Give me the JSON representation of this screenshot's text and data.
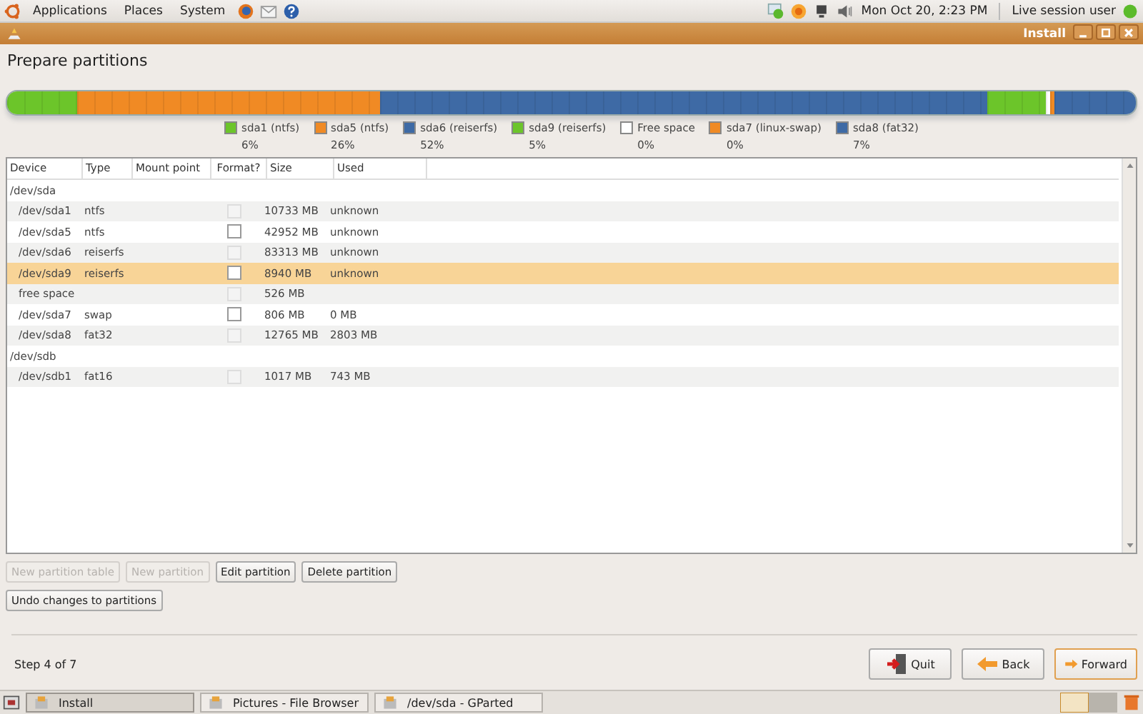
{
  "top_panel": {
    "menus": [
      "Applications",
      "Places",
      "System"
    ],
    "clock": "Mon Oct 20,  2:23 PM",
    "user": "Live session user"
  },
  "window": {
    "title": "Install"
  },
  "heading": "Prepare partitions",
  "partitions_bar": [
    {
      "name": "sda1 (ntfs)",
      "percent": "6%",
      "color": "#6cc52a"
    },
    {
      "name": "sda5 (ntfs)",
      "percent": "26%",
      "color": "#f08a24"
    },
    {
      "name": "sda6 (reiserfs)",
      "percent": "52%",
      "color": "#3e6aa5"
    },
    {
      "name": "sda9 (reiserfs)",
      "percent": "5%",
      "color": "#6cc52a"
    },
    {
      "name": "Free space",
      "percent": "0%",
      "color": "#ffffff"
    },
    {
      "name": "sda7 (linux-swap)",
      "percent": "0%",
      "color": "#f08a24"
    },
    {
      "name": "sda8 (fat32)",
      "percent": "7%",
      "color": "#3e6aa5"
    }
  ],
  "table": {
    "columns": [
      "Device",
      "Type",
      "Mount point",
      "Format?",
      "Size",
      "Used"
    ],
    "rows": [
      {
        "kind": "disk",
        "device": "/dev/sda",
        "selected": false
      },
      {
        "kind": "partition",
        "device": "/dev/sda1",
        "type": "ntfs",
        "format_checked": false,
        "disabled": true,
        "size": "10733 MB",
        "used": "unknown",
        "selected": false
      },
      {
        "kind": "partition",
        "device": "/dev/sda5",
        "type": "ntfs",
        "format_checked": false,
        "disabled": false,
        "size": "42952 MB",
        "used": "unknown",
        "selected": false
      },
      {
        "kind": "partition",
        "device": "/dev/sda6",
        "type": "reiserfs",
        "format_checked": false,
        "disabled": true,
        "size": "83313 MB",
        "used": "unknown",
        "selected": false
      },
      {
        "kind": "partition",
        "device": "/dev/sda9",
        "type": "reiserfs",
        "format_checked": false,
        "disabled": false,
        "size": "8940 MB",
        "used": "unknown",
        "selected": true
      },
      {
        "kind": "partition",
        "device": "free space",
        "type": "",
        "format_checked": false,
        "disabled": true,
        "size": "526 MB",
        "used": "",
        "selected": false
      },
      {
        "kind": "partition",
        "device": "/dev/sda7",
        "type": "swap",
        "format_checked": false,
        "disabled": false,
        "size": "806 MB",
        "used": "0 MB",
        "selected": false
      },
      {
        "kind": "partition",
        "device": "/dev/sda8",
        "type": "fat32",
        "format_checked": false,
        "disabled": true,
        "size": "12765 MB",
        "used": "2803 MB",
        "selected": false
      },
      {
        "kind": "disk",
        "device": "/dev/sdb",
        "selected": false
      },
      {
        "kind": "partition",
        "device": "/dev/sdb1",
        "type": "fat16",
        "format_checked": false,
        "disabled": true,
        "size": "1017 MB",
        "used": "743 MB",
        "selected": false
      }
    ]
  },
  "actions": [
    {
      "label": "New partition table",
      "disabled": true
    },
    {
      "label": "New partition",
      "disabled": true
    },
    {
      "label": "Edit partition",
      "disabled": false
    },
    {
      "label": "Delete partition",
      "disabled": false
    }
  ],
  "undo_button": {
    "label": "Undo changes to partitions",
    "disabled": false
  },
  "step": "Step 4 of 7",
  "nav_buttons": [
    {
      "kind": "quit",
      "label": "Quit"
    },
    {
      "kind": "back",
      "label": "Back"
    },
    {
      "kind": "forward",
      "label": "Forward"
    }
  ],
  "taskbar": [
    {
      "label": "Install",
      "selected": true
    },
    {
      "label": "Pictures - File Browser",
      "selected": false
    },
    {
      "label": "/dev/sda - GParted",
      "selected": false
    }
  ]
}
